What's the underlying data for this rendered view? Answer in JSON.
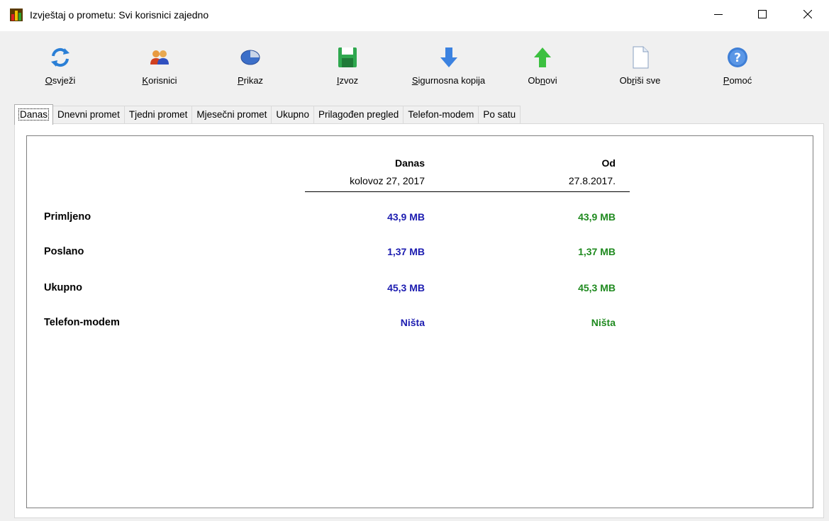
{
  "window": {
    "title": "Izvještaj o prometu: Svi korisnici zajedno"
  },
  "toolbar": [
    {
      "pre": "",
      "u": "O",
      "post": "svježi",
      "icon": "refresh-icon"
    },
    {
      "pre": "",
      "u": "K",
      "post": "orisnici",
      "icon": "users-icon"
    },
    {
      "pre": "",
      "u": "P",
      "post": "rikaz",
      "icon": "view-icon"
    },
    {
      "pre": "",
      "u": "I",
      "post": "zvoz",
      "icon": "save-icon"
    },
    {
      "pre": "",
      "u": "S",
      "post": "igurnosna kopija",
      "icon": "arrow-down-icon"
    },
    {
      "pre": "Ob",
      "u": "n",
      "post": "ovi",
      "icon": "arrow-up-icon"
    },
    {
      "pre": "Ob",
      "u": "r",
      "post": "iši sve",
      "icon": "blank-page-icon"
    },
    {
      "pre": "",
      "u": "P",
      "post": "omoć",
      "icon": "help-icon"
    }
  ],
  "tabs": [
    "Danas",
    "Dnevni promet",
    "Tjedni promet",
    "Mjesečni promet",
    "Ukupno",
    "Prilagođen pregled",
    "Telefon-modem",
    "Po satu"
  ],
  "report": {
    "col1_title": "Danas",
    "col1_date": "kolovoz 27, 2017",
    "col2_title": "Od",
    "col2_date": "27.8.2017.",
    "rows": [
      {
        "label": "Primljeno",
        "today": "43,9 MB",
        "since": "43,9 MB"
      },
      {
        "label": "Poslano",
        "today": "1,37 MB",
        "since": "1,37 MB"
      },
      {
        "label": "Ukupno",
        "today": "45,3 MB",
        "since": "45,3 MB"
      },
      {
        "label": "Telefon-modem",
        "today": "Ništa",
        "since": "Ništa"
      }
    ]
  },
  "colors": {
    "today_value": "#1c1cb0",
    "since_value": "#1f8a1f"
  }
}
